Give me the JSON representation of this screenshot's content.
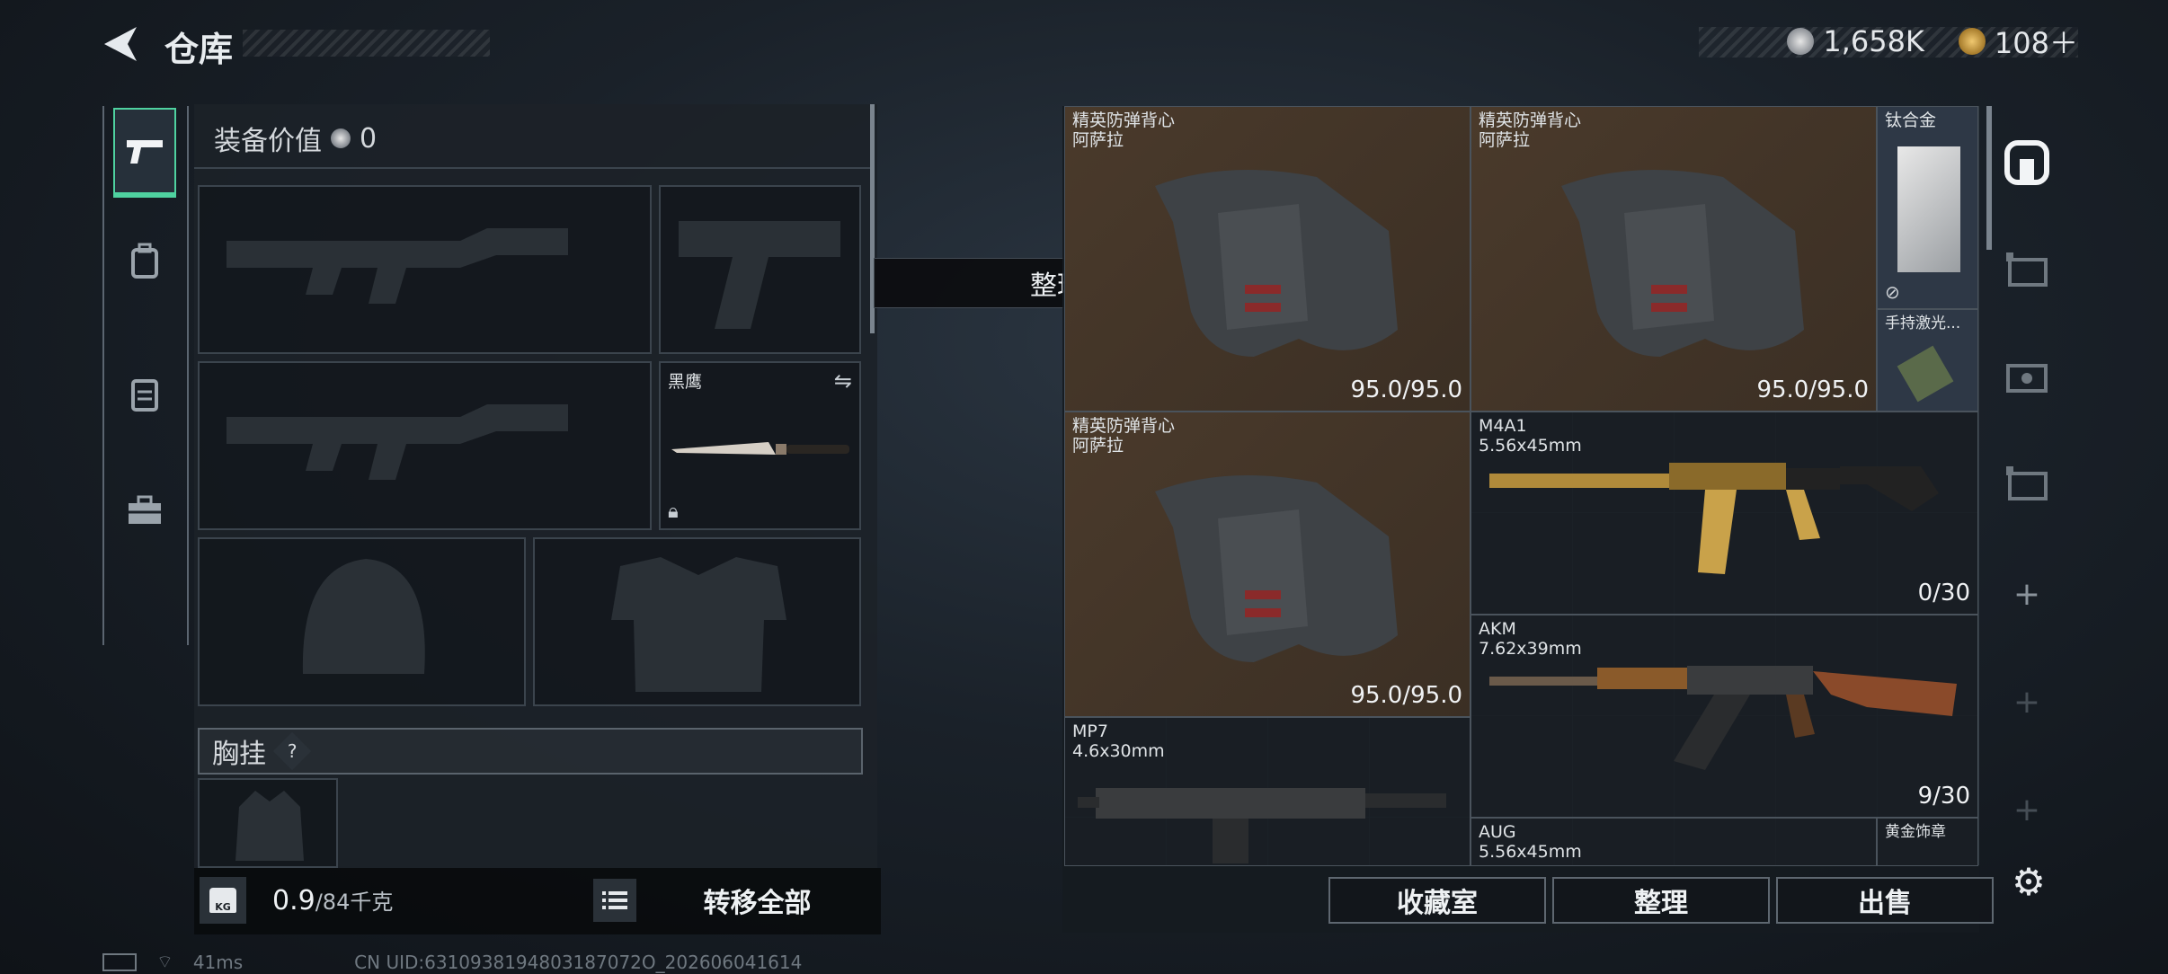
{
  "header": {
    "title": "仓库",
    "silver": "1,658K",
    "gold": "108＋"
  },
  "left_tabs": [
    {
      "icon": "pistol-icon",
      "selected": true
    },
    {
      "icon": "backpack-icon",
      "selected": false
    },
    {
      "icon": "vest-icon",
      "selected": false
    },
    {
      "icon": "toolbox-icon",
      "selected": false
    }
  ],
  "equipment": {
    "value_label": "装备价值",
    "value": "0",
    "knife_name": "黑鹰",
    "chest_rig_label": "胸挂",
    "chest_rig_help": "?",
    "weight": "0.9",
    "weight_max": "/84千克",
    "weight_icon": "KG",
    "transfer_all": "转移全部"
  },
  "toast": "整理成功",
  "inventory": {
    "items": [
      {
        "name": "精英防弹背心",
        "sub": "阿萨拉",
        "count": "95.0/95.0"
      },
      {
        "name": "精英防弹背心",
        "sub": "阿萨拉",
        "count": "95.0/95.0"
      },
      {
        "name": "钛合金",
        "sub": "",
        "count": ""
      },
      {
        "name": "手持激光...",
        "sub": "",
        "count": ""
      },
      {
        "name": "精英防弹背心",
        "sub": "阿萨拉",
        "count": "95.0/95.0"
      },
      {
        "name": "M4A1",
        "sub": "5.56x45mm",
        "count": "0/30"
      },
      {
        "name": "AKM",
        "sub": "7.62x39mm",
        "count": "9/30"
      },
      {
        "name": "MP7",
        "sub": "4.6x30mm",
        "count": ""
      },
      {
        "name": "AUG",
        "sub": "5.56x45mm",
        "count": ""
      },
      {
        "name": "黄金饰章",
        "sub": "",
        "count": ""
      }
    ]
  },
  "buttons": {
    "collection": "收藏室",
    "sort": "整理",
    "sell": "出售"
  },
  "side_add": [
    "+",
    "+",
    "+"
  ],
  "status": {
    "ping": "41ms",
    "uid": "CN UID:6310938194803187072О_202606041614"
  }
}
